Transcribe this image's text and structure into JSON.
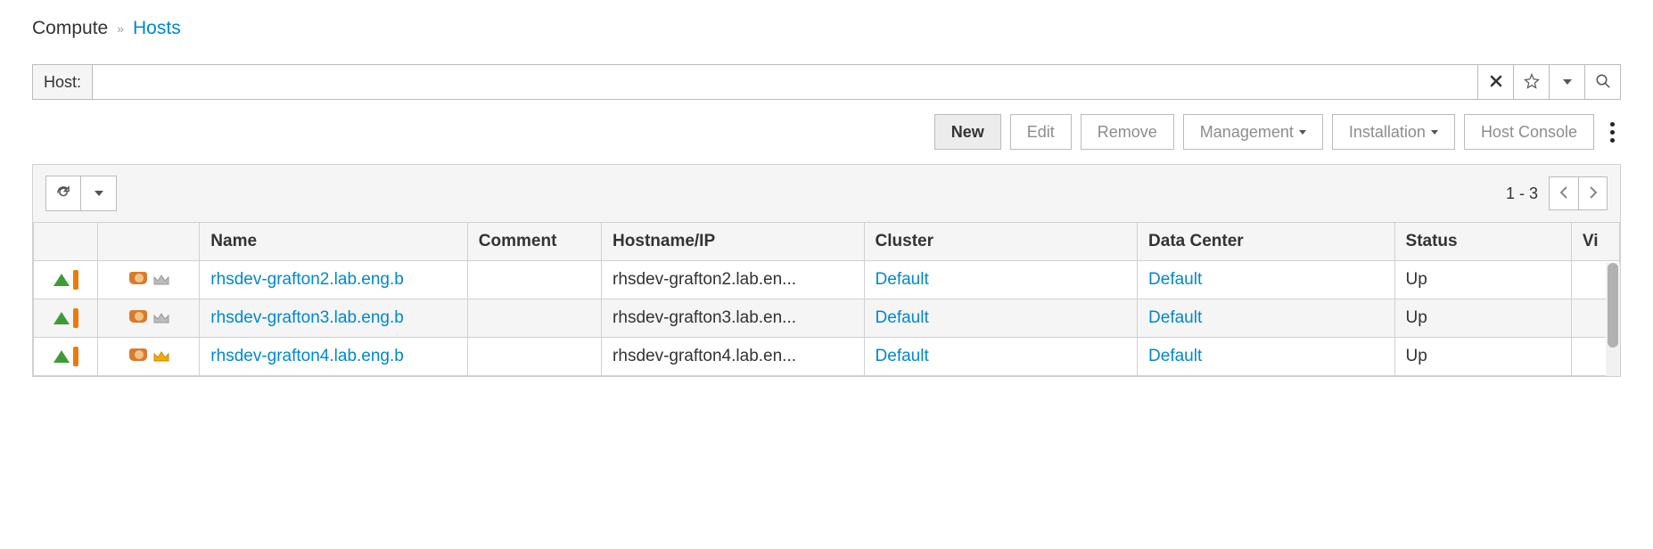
{
  "breadcrumb": {
    "root": "Compute",
    "current": "Hosts"
  },
  "search": {
    "label": "Host:",
    "value": ""
  },
  "toolbar": {
    "new": "New",
    "edit": "Edit",
    "remove": "Remove",
    "management": "Management",
    "installation": "Installation",
    "host_console": "Host Console"
  },
  "pagination": {
    "range": "1 - 3"
  },
  "table": {
    "headers": {
      "name": "Name",
      "comment": "Comment",
      "hostname": "Hostname/IP",
      "cluster": "Cluster",
      "data_center": "Data Center",
      "status": "Status",
      "vi": "Vi"
    },
    "rows": [
      {
        "name": "rhsdev-grafton2.lab.eng.b",
        "comment": "",
        "hostname": "rhsdev-grafton2.lab.en...",
        "cluster": "Default",
        "data_center": "Default",
        "status": "Up",
        "crown_gold": false
      },
      {
        "name": "rhsdev-grafton3.lab.eng.b",
        "comment": "",
        "hostname": "rhsdev-grafton3.lab.en...",
        "cluster": "Default",
        "data_center": "Default",
        "status": "Up",
        "crown_gold": false
      },
      {
        "name": "rhsdev-grafton4.lab.eng.b",
        "comment": "",
        "hostname": "rhsdev-grafton4.lab.en...",
        "cluster": "Default",
        "data_center": "Default",
        "status": "Up",
        "crown_gold": true
      }
    ]
  }
}
